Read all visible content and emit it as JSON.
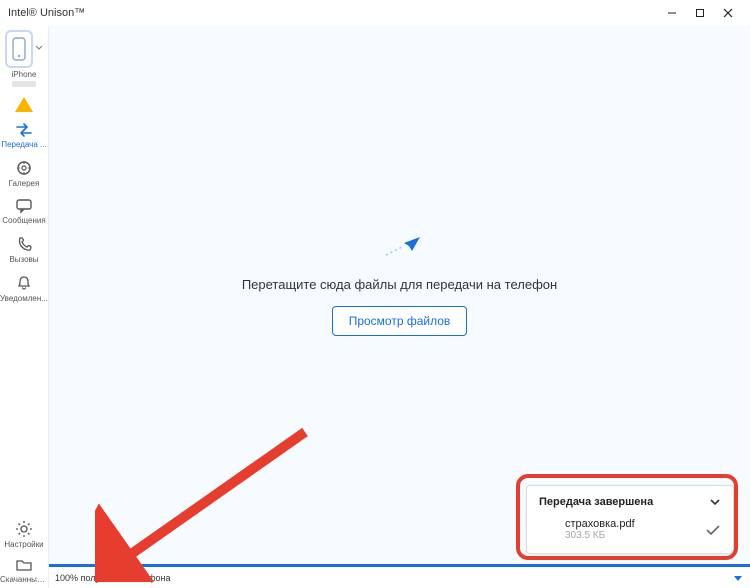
{
  "window": {
    "title": "Intel® Unison™"
  },
  "sidebar": {
    "device_label": "iPhone",
    "items": [
      {
        "label": "Передача ...",
        "icon": "transfer"
      },
      {
        "label": "Галерея",
        "icon": "gallery"
      },
      {
        "label": "Сообщения",
        "icon": "messages"
      },
      {
        "label": "Вызовы",
        "icon": "calls"
      },
      {
        "label": "Уведомлен...",
        "icon": "notifications"
      }
    ],
    "settings_label": "Настройки",
    "downloads_label": "Скачанные..."
  },
  "main": {
    "drop_hint": "Перетащите сюда файлы для передачи на телефон",
    "browse_label": "Просмотр файлов"
  },
  "statusbar": {
    "text": "100% получено с телефона"
  },
  "toast": {
    "title": "Передача завершена",
    "file_name": "страховка.pdf",
    "file_size": "303.5 КБ"
  }
}
